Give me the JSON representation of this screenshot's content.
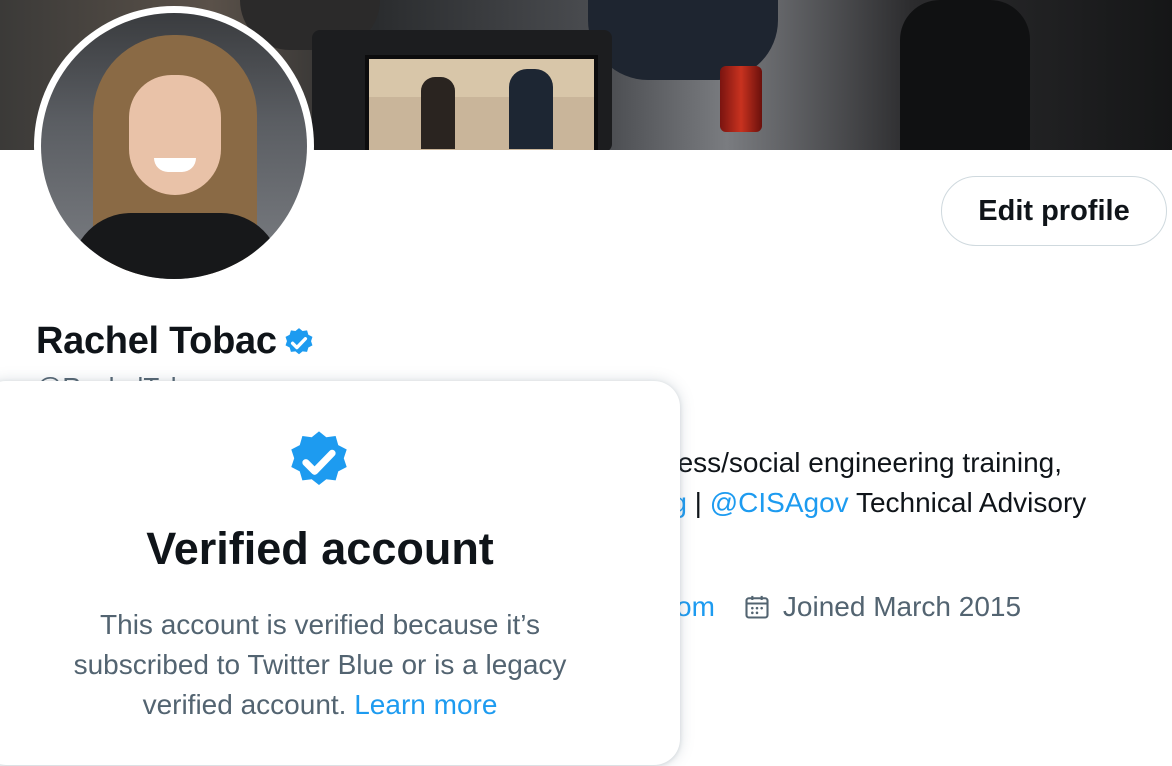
{
  "profile": {
    "name": "Rachel Tobac",
    "handle": "@RachelTobac",
    "edit_profile_label": "Edit profile",
    "bio_line1": "ness/social engineering training,",
    "bio_line2_link_partial": "rg",
    "bio_line2_separator": " | ",
    "bio_line2_mention": "@CISAgov",
    "bio_line2_rest": " Technical Advisory",
    "website_partial": "com",
    "joined": "Joined March 2015"
  },
  "popup": {
    "title": "Verified account",
    "body": "This account is verified because it’s subscribed to Twitter Blue or is a legacy verified account.",
    "learn_more": "Learn more"
  },
  "icons": {
    "verified": "verified-badge-icon",
    "calendar": "calendar-icon"
  },
  "colors": {
    "accent": "#1d9bf0",
    "text": "#0f1419",
    "secondary": "#536471"
  }
}
